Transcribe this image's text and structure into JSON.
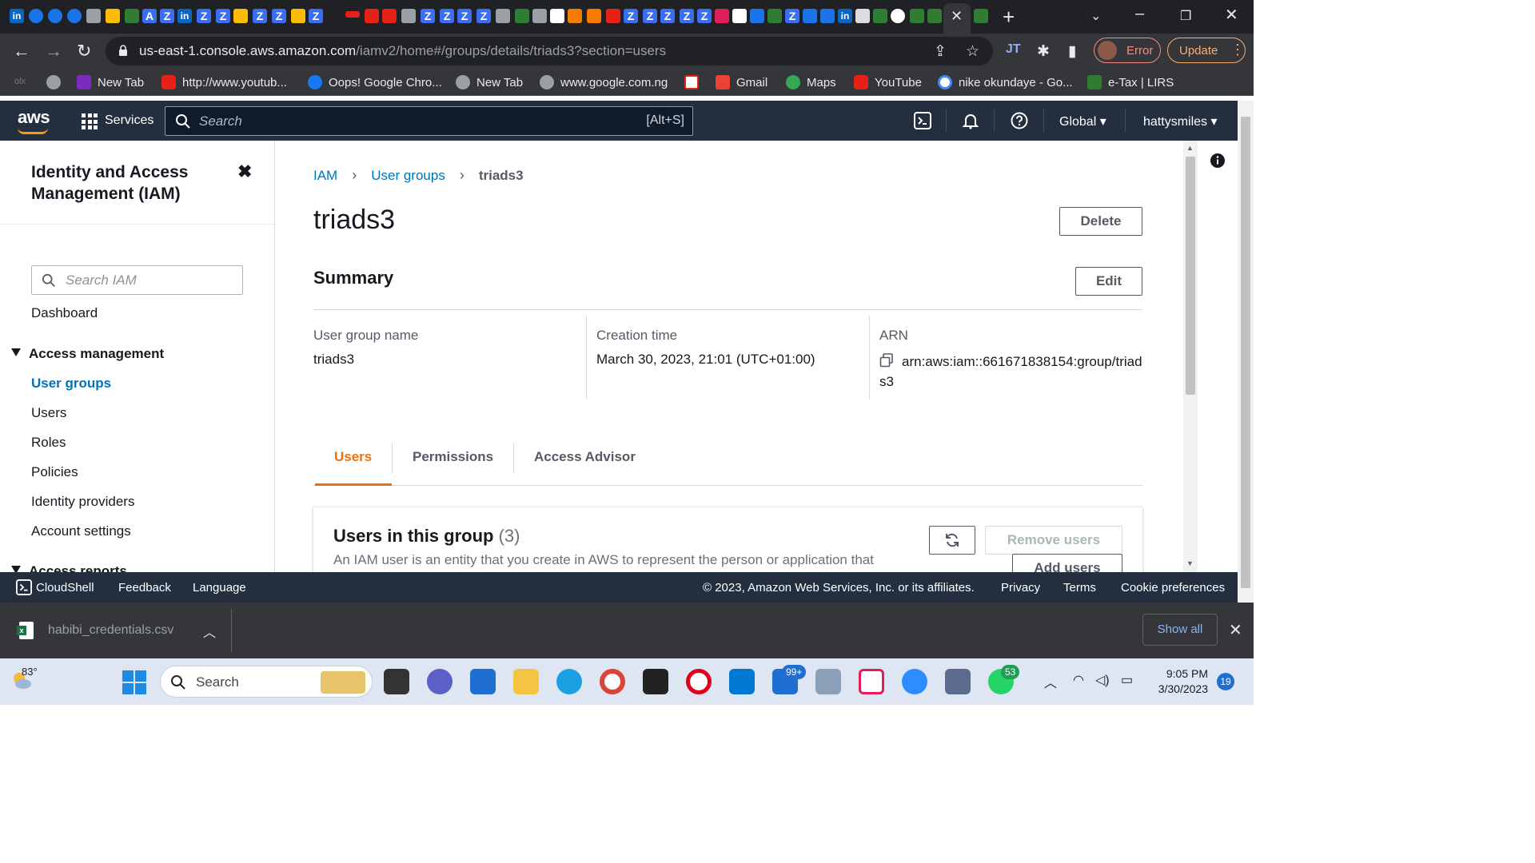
{
  "browser": {
    "url_host": "us-east-1.console.aws.amazon.com",
    "url_path": "/iamv2/home#/groups/details/triads3?section=users",
    "profile_status": "Error",
    "update_label": "Update",
    "bookmarks": [
      {
        "label": "New Tab"
      },
      {
        "label": "http://www.youtub..."
      },
      {
        "label": "Oops! Google Chro..."
      },
      {
        "label": "New Tab"
      },
      {
        "label": "www.google.com.ng"
      },
      {
        "label": "Gmail"
      },
      {
        "label": "Maps"
      },
      {
        "label": "YouTube"
      },
      {
        "label": "nike okundaye - Go..."
      },
      {
        "label": "e-Tax | LIRS"
      }
    ]
  },
  "aws_nav": {
    "logo": "aws",
    "services_label": "Services",
    "search_placeholder": "Search",
    "search_shortcut": "[Alt+S]",
    "region": "Global",
    "account": "hattysmiles"
  },
  "sidenav": {
    "title": "Identity and Access Management (IAM)",
    "search_placeholder": "Search IAM",
    "dashboard": "Dashboard",
    "section_access_management": "Access management",
    "items": [
      "User groups",
      "Users",
      "Roles",
      "Policies",
      "Identity providers",
      "Account settings"
    ],
    "section_access_reports": "Access reports"
  },
  "main": {
    "breadcrumb": [
      "IAM",
      "User groups",
      "triads3"
    ],
    "title": "triads3",
    "delete_label": "Delete",
    "summary_title": "Summary",
    "edit_label": "Edit",
    "summary": {
      "group_name_key": "User group name",
      "group_name_value": "triads3",
      "creation_key": "Creation time",
      "creation_value": "March 30, 2023, 21:01 (UTC+01:00)",
      "arn_key": "ARN",
      "arn_value": "arn:aws:iam::661671838154:group/triads3"
    },
    "tabs": [
      "Users",
      "Permissions",
      "Access Advisor"
    ],
    "users_panel": {
      "title": "Users in this group",
      "count": "(3)",
      "description": "An IAM user is an entity that you create in AWS to represent the person or application that uses it to interact with AWS.",
      "remove_label": "Remove users",
      "add_label": "Add users"
    }
  },
  "footer": {
    "cloudshell": "CloudShell",
    "feedback": "Feedback",
    "language": "Language",
    "copyright": "© 2023, Amazon Web Services, Inc. or its affiliates.",
    "privacy": "Privacy",
    "terms": "Terms",
    "cookies": "Cookie preferences"
  },
  "downloads": {
    "filename": "habibi_credentials.csv",
    "show_all": "Show all"
  },
  "taskbar": {
    "temperature": "83°",
    "search_label": "Search",
    "mail_badge": "99+",
    "whatsapp_badge": "53",
    "time": "9:05 PM",
    "date": "3/30/2023",
    "notifications": "19"
  },
  "colors": {
    "aws_nav_bg": "#232f3e",
    "link_blue": "#0073bb",
    "active_tab_orange": "#ec7211",
    "aws_orange": "#ff9900"
  }
}
